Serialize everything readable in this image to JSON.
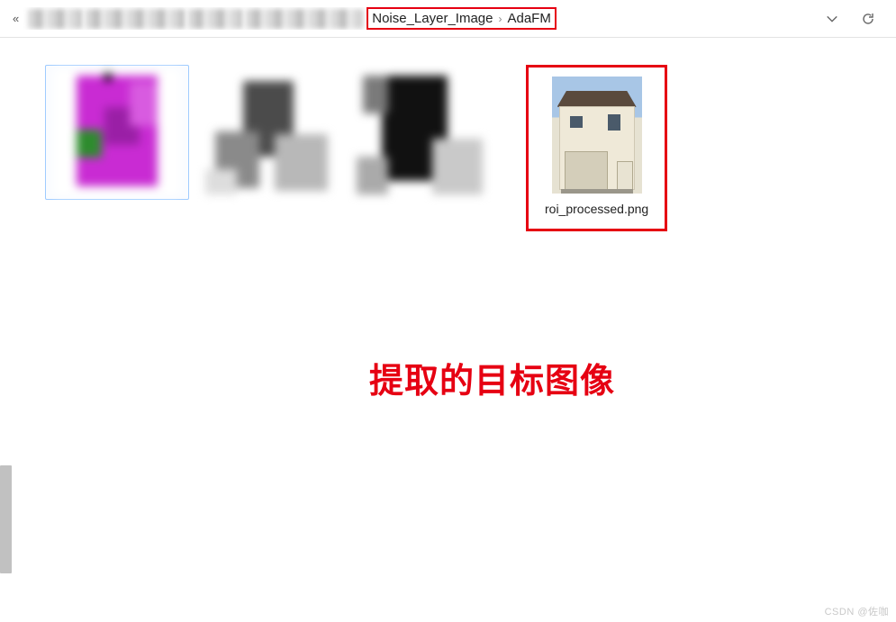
{
  "breadcrumb": {
    "chevrons": "«",
    "segments": [
      {
        "label": "Noise_Layer_Image"
      },
      {
        "label": "AdaFM"
      }
    ],
    "separator": "›"
  },
  "files": [
    {
      "name": "roi_processed.png"
    }
  ],
  "annotation": "提取的目标图像",
  "watermark": "CSDN @佐咖"
}
